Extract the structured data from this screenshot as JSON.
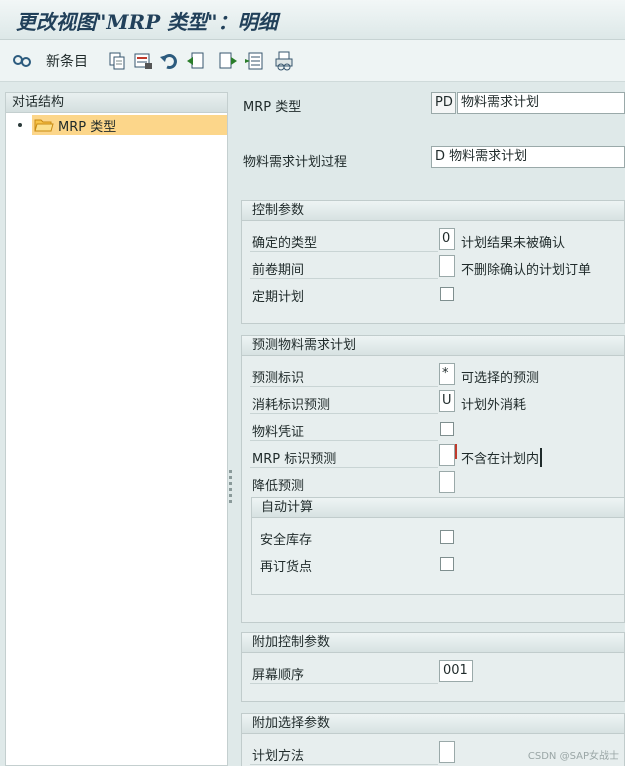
{
  "title": "更改视图\"MRP 类型\"：明细",
  "toolbar": {
    "new_entries_label": "新条目",
    "icons": [
      "glasses-icon",
      "copy-icon",
      "delete-icon",
      "undo-icon",
      "select-all-icon",
      "deselect-icon",
      "select-block-icon",
      "print-icon"
    ]
  },
  "left": {
    "header": "对话结构",
    "tree_item": "MRP 类型"
  },
  "top_fields": {
    "mrp_type_label": "MRP 类型",
    "mrp_type_code": "PD",
    "mrp_type_desc": "物料需求计划",
    "mrp_procedure_label": "物料需求计划过程",
    "mrp_procedure_value": "D 物料需求计划"
  },
  "control": {
    "header": "控制参数",
    "firming_type_label": "确定的类型",
    "firming_type_value": "0",
    "firming_type_desc": "计划结果未被确认",
    "roll_forward_label": "前卷期间",
    "roll_forward_value": "",
    "roll_forward_desc": "不删除确认的计划订单",
    "time_phased_label": "定期计划"
  },
  "forecast": {
    "header": "预测物料需求计划",
    "forecast_ind_label": "预测标识",
    "forecast_ind_value": "*",
    "forecast_ind_desc": "可选择的预测",
    "consumption_label": "消耗标识预测",
    "consumption_value": "U",
    "consumption_desc": "计划外消耗",
    "material_doc_label": "物料凭证",
    "mrp_ind_label": "MRP 标识预测",
    "mrp_ind_value": "",
    "mrp_ind_desc": "不含在计划内",
    "reduce_label": "降低预测",
    "reduce_value": "",
    "auto_calc": {
      "header": "自动计算",
      "safety_stock_label": "安全库存",
      "reorder_point_label": "再订货点"
    }
  },
  "additional_control": {
    "header": "附加控制参数",
    "screen_seq_label": "屏幕顺序",
    "screen_seq_value": "001"
  },
  "additional_select": {
    "header": "附加选择参数",
    "planning_method_label": "计划方法",
    "planning_method_value": ""
  },
  "watermark": "CSDN @SAP女战士"
}
